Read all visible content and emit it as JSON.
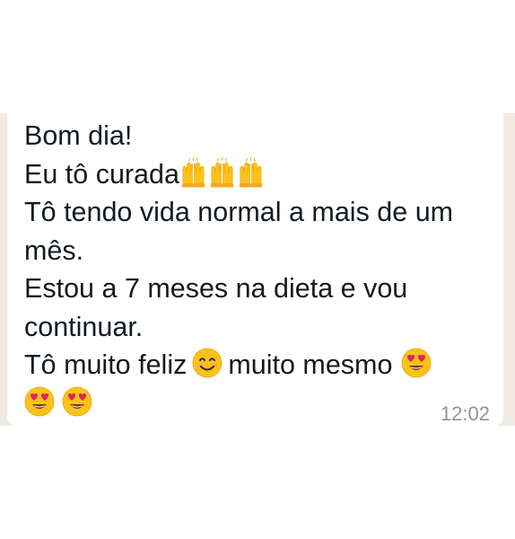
{
  "message": {
    "line1": "Bom dia!",
    "line2_text": "Eu tô curada",
    "line3": "Tô tendo vida normal a mais de um",
    "line4": "mês.",
    "line5": "Estou a 7 meses na dieta e vou",
    "line6": "continuar.",
    "line7_part1": "Tô muito feliz",
    "line7_part2": "muito mesmo",
    "timestamp": "12:02"
  },
  "emoji_icons": {
    "raising_hands": "raising-hands-icon",
    "smiling_face": "smiling-face-icon",
    "heart_eyes": "heart-eyes-icon"
  },
  "colors": {
    "chat_background": "#efeae2",
    "bubble": "#ffffff",
    "text": "#111b21",
    "timestamp": "#8696a0",
    "emoji_face": "#fcc21b",
    "emoji_heart": "#e0245e"
  }
}
